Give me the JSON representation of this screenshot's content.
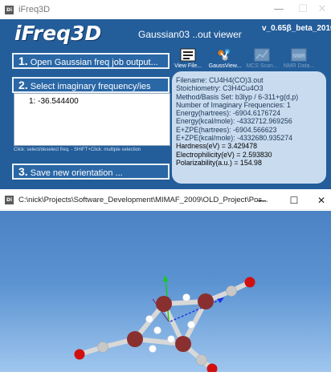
{
  "app_window": {
    "title": "iFreq3D",
    "controls": {
      "minimize": "—",
      "maximize": "☐",
      "close": "✕"
    },
    "logo": "iFreq3D",
    "subtitle": "Gaussian03 ..out viewer",
    "version": "v_0.65β_beta_2010",
    "buttons": [
      {
        "num": "1.",
        "label": "Open Gaussian freq job output..."
      },
      {
        "num": "2.",
        "label": "Select imaginary frequency/ies"
      },
      {
        "num": "3.",
        "label": "Save new orientation ..."
      }
    ],
    "frequencies": [
      "1: -36.544400"
    ],
    "hint": "Click: select/deselect freq. - SHIFT+Click: multiple selection",
    "toolbar": [
      {
        "label": "View File...",
        "icon": "view-file-icon",
        "enabled": true
      },
      {
        "label": "GaussView...",
        "icon": "gaussview-icon",
        "enabled": true
      },
      {
        "label": "MCS Scan...",
        "icon": "mcs-scan-icon",
        "enabled": false
      },
      {
        "label": "NMR Data...",
        "icon": "nmr-data-icon",
        "enabled": false
      }
    ],
    "info": {
      "filename": "Filename: CU4H4(CO)3.out",
      "stoichiometry": "Stoichiometry: C3H4Cu4O3",
      "method": "Method/Basis Set: b3lyp / 6-311+g(d,p)",
      "num_imag": "Number of Imaginary Frequencies: 1",
      "energy_h": "Energy(hartrees): -6904.6176724",
      "energy_k": "Energy(kcal/mole): -4332712.969256",
      "ezpe_h": "E+ZPE(hartrees): -6904.566623",
      "ezpe_k": "E+ZPE(kcal/mole): -4332680.935274",
      "hardness": "Hardness(eV) = 3.429478",
      "electrophilicity": "Electrophilicity(eV) = 2.593830",
      "polarizability": "Polarizability(a.u.) = 154.98"
    }
  },
  "viewer_window": {
    "title": "C:\\nick\\Projects\\Software_Development\\MIMAF_2009\\OLD_Project\\Pos...",
    "controls": {
      "minimize": "—",
      "maximize": "☐",
      "close": "✕"
    },
    "colors": {
      "copper": "#8a2f2f",
      "carbon": "#c8c8c8",
      "oxygen": "#d01010",
      "hydrogen": "#ffffff",
      "bond": "#d8d8d8",
      "axis_y": "#11cc11",
      "vector": "#1a2fe6"
    }
  }
}
